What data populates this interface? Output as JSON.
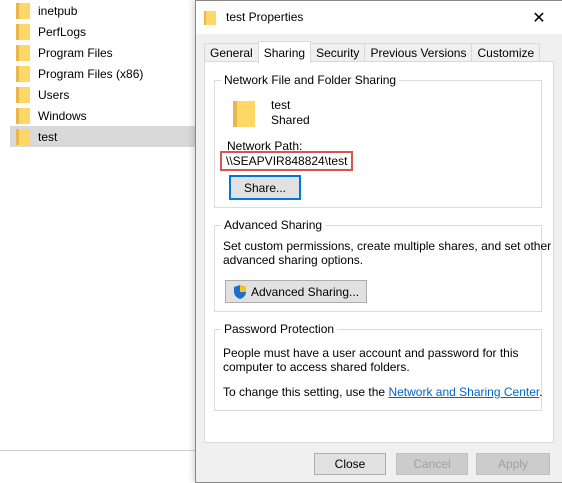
{
  "explorer": {
    "items": [
      {
        "label": "inetpub"
      },
      {
        "label": "PerfLogs"
      },
      {
        "label": "Program Files"
      },
      {
        "label": "Program Files (x86)"
      },
      {
        "label": "Users"
      },
      {
        "label": "Windows"
      },
      {
        "label": "test"
      }
    ],
    "selected_item": "test"
  },
  "dialog": {
    "title": "test Properties",
    "close_glyph": "✕",
    "tabs": [
      {
        "label": "General"
      },
      {
        "label": "Sharing"
      },
      {
        "label": "Security"
      },
      {
        "label": "Previous Versions"
      },
      {
        "label": "Customize"
      }
    ],
    "active_tab": "Sharing",
    "network_sharing": {
      "title": "Network File and Folder Sharing",
      "folder_name": "test",
      "status": "Shared",
      "path_label": "Network Path:",
      "path": "\\\\SEAPVIR848824\\test",
      "share_button": "Share..."
    },
    "advanced_sharing": {
      "title": "Advanced Sharing",
      "description_line1": "Set custom permissions, create multiple shares, and set other",
      "description_line2": "advanced sharing options.",
      "button": "Advanced Sharing..."
    },
    "password_protection": {
      "title": "Password Protection",
      "line1": "People must have a user account and password for this",
      "line2": "computer to access shared folders.",
      "change_prefix": "To change this setting, use the ",
      "link": "Network and Sharing Center",
      "change_suffix": "."
    },
    "buttons": {
      "close": "Close",
      "cancel": "Cancel",
      "apply": "Apply"
    },
    "colors": {
      "folder": "#ffd767",
      "highlight": "#d9534f",
      "link": "#0066cc",
      "focus": "#0078d7"
    }
  }
}
